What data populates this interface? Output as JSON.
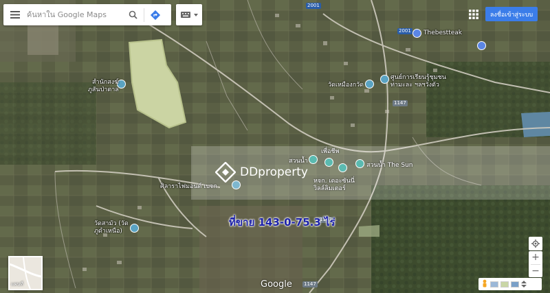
{
  "search": {
    "placeholder": "ค้นหาใน Google Maps"
  },
  "header": {
    "signin_label": "ลงชื่อเข้าสู่ระบบ"
  },
  "places": [
    {
      "label": "Thebestteak",
      "key": "thebestteak"
    },
    {
      "label": "สำนักสงฆ์\nภูสันป่าตาล",
      "key": "samnak"
    },
    {
      "label": "วัดเหมืองกวัด",
      "key": "wat-muang"
    },
    {
      "label": "ศูนย์การเรียนรู้ชุมชน\nท่ามะละ ฯลฯวังตัว",
      "key": "community-center"
    },
    {
      "label": "เพื่อชีพ",
      "key": "puachip"
    },
    {
      "label": "สวนน้ำ",
      "key": "suan-nam"
    },
    {
      "label": "สวนน้ำ The Sun",
      "key": "the-sun"
    },
    {
      "label": "หจก. เดอะซันนี่\nวิลล์ลิมเตอร์",
      "key": "sunny"
    },
    {
      "label": "ศิลาราไฟมอนด์ เบจก",
      "key": "sila"
    },
    {
      "label": "วัดสามัว (วัด\nภูดำเหนือ)",
      "key": "wat-samua"
    }
  ],
  "routes": [
    "2001",
    "2001",
    "1147",
    "1147",
    "1147"
  ],
  "watermark": {
    "brand": "DDproperty"
  },
  "listing": {
    "price_text": "ที่ขาย 143-0-75.3 ไร่"
  },
  "minimap": {
    "label": "แผนที่"
  },
  "footer": {
    "google": "Google"
  },
  "controls": {
    "zoom_in": "+",
    "zoom_out": "−"
  },
  "icons": {
    "menu": "hamburger-icon",
    "search": "magnifier-icon",
    "directions": "directions-diamond-icon",
    "keyboard": "keyboard-icon",
    "apps": "grid-icon",
    "locate": "target-icon",
    "pegman": "pegman-icon"
  },
  "colors": {
    "signin": "#3b7de9",
    "price": "#1d22a8",
    "pin": "#5aa3c2"
  }
}
